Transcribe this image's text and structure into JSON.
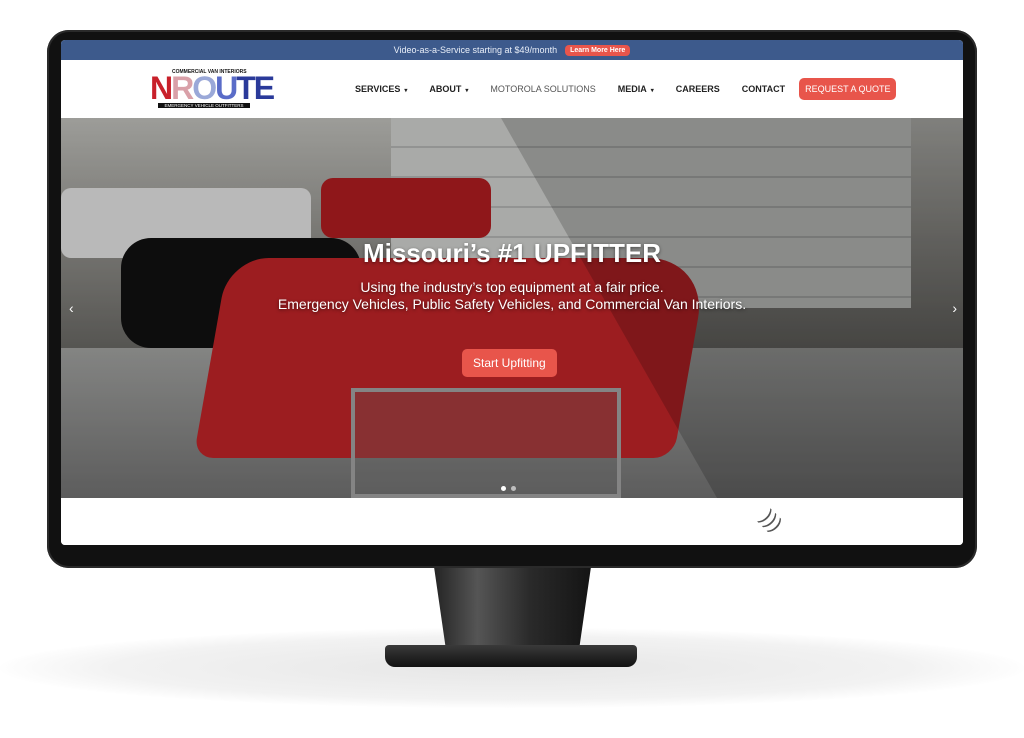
{
  "announcement": {
    "text": "Video-as-a-Service starting at $49/month",
    "button": "Learn More Here"
  },
  "logo": {
    "top": "COMMERCIAL VAN INTERIORS",
    "main": "NROUTE",
    "suffix": "LLC",
    "bottom": "EMERGENCY VEHICLE OUTFITTERS"
  },
  "nav": {
    "items": [
      {
        "label": "SERVICES",
        "dropdown": true
      },
      {
        "label": "ABOUT",
        "dropdown": true
      },
      {
        "label": "MOTOROLA SOLUTIONS",
        "dropdown": false
      },
      {
        "label": "MEDIA",
        "dropdown": true
      },
      {
        "label": "CAREERS",
        "dropdown": false
      },
      {
        "label": "CONTACT",
        "dropdown": false
      }
    ],
    "cta": "REQUEST A QUOTE",
    "caret": "▾"
  },
  "hero": {
    "title": "Missouri’s #1 UPFITTER",
    "subtitle_line1": "Using the industry’s top equipment at a fair price.",
    "subtitle_line2": "Emergency Vehicles, Public Safety Vehicles, and Commercial Van Interiors.",
    "button": "Start Upfitting",
    "prev": "‹",
    "next": "›"
  },
  "colors": {
    "accent": "#e8554b",
    "topbar": "#3d5a8c"
  }
}
